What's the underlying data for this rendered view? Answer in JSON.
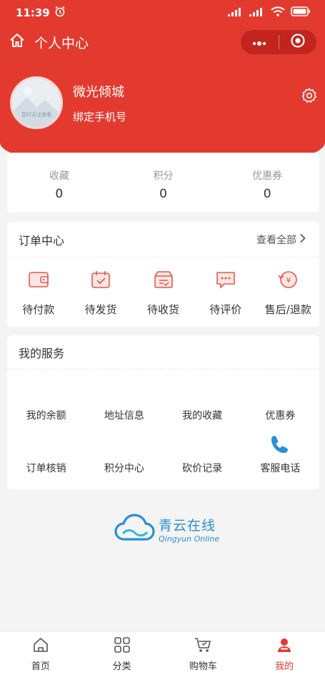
{
  "status_bar": {
    "time": "11:39"
  },
  "nav": {
    "title": "个人中心"
  },
  "profile": {
    "name": "微光倾城",
    "phone_label": "绑定手机号",
    "avatar_caption": "暂时无法查看"
  },
  "stats": [
    {
      "label": "收藏",
      "value": "0"
    },
    {
      "label": "积分",
      "value": "0"
    },
    {
      "label": "优惠券",
      "value": "0"
    }
  ],
  "orders": {
    "title": "订单中心",
    "view_all": "查看全部",
    "items": [
      {
        "label": "待付款",
        "icon": "wallet-icon"
      },
      {
        "label": "待发货",
        "icon": "calendar-check-icon"
      },
      {
        "label": "待收货",
        "icon": "package-icon"
      },
      {
        "label": "待评价",
        "icon": "comment-icon"
      },
      {
        "label": "售后/退款",
        "icon": "refund-icon"
      }
    ]
  },
  "services": {
    "title": "我的服务",
    "items": [
      {
        "label": "我的余额"
      },
      {
        "label": "地址信息"
      },
      {
        "label": "我的收藏"
      },
      {
        "label": "优惠券"
      },
      {
        "label": "订单核销"
      },
      {
        "label": "积分中心"
      },
      {
        "label": "砍价记录"
      },
      {
        "label": "客服电话",
        "icon": "phone-icon"
      }
    ]
  },
  "brand": {
    "name_cn": "青云在线",
    "name_en": "Qingyun Online"
  },
  "tabbar": {
    "items": [
      {
        "label": "首页",
        "icon": "home-icon"
      },
      {
        "label": "分类",
        "icon": "grid-icon"
      },
      {
        "label": "购物车",
        "icon": "cart-icon"
      },
      {
        "label": "我的",
        "icon": "user-icon"
      }
    ],
    "active_index": 3
  },
  "colors": {
    "primary": "#e33a2f",
    "accent_blue": "#2a8fd8"
  }
}
